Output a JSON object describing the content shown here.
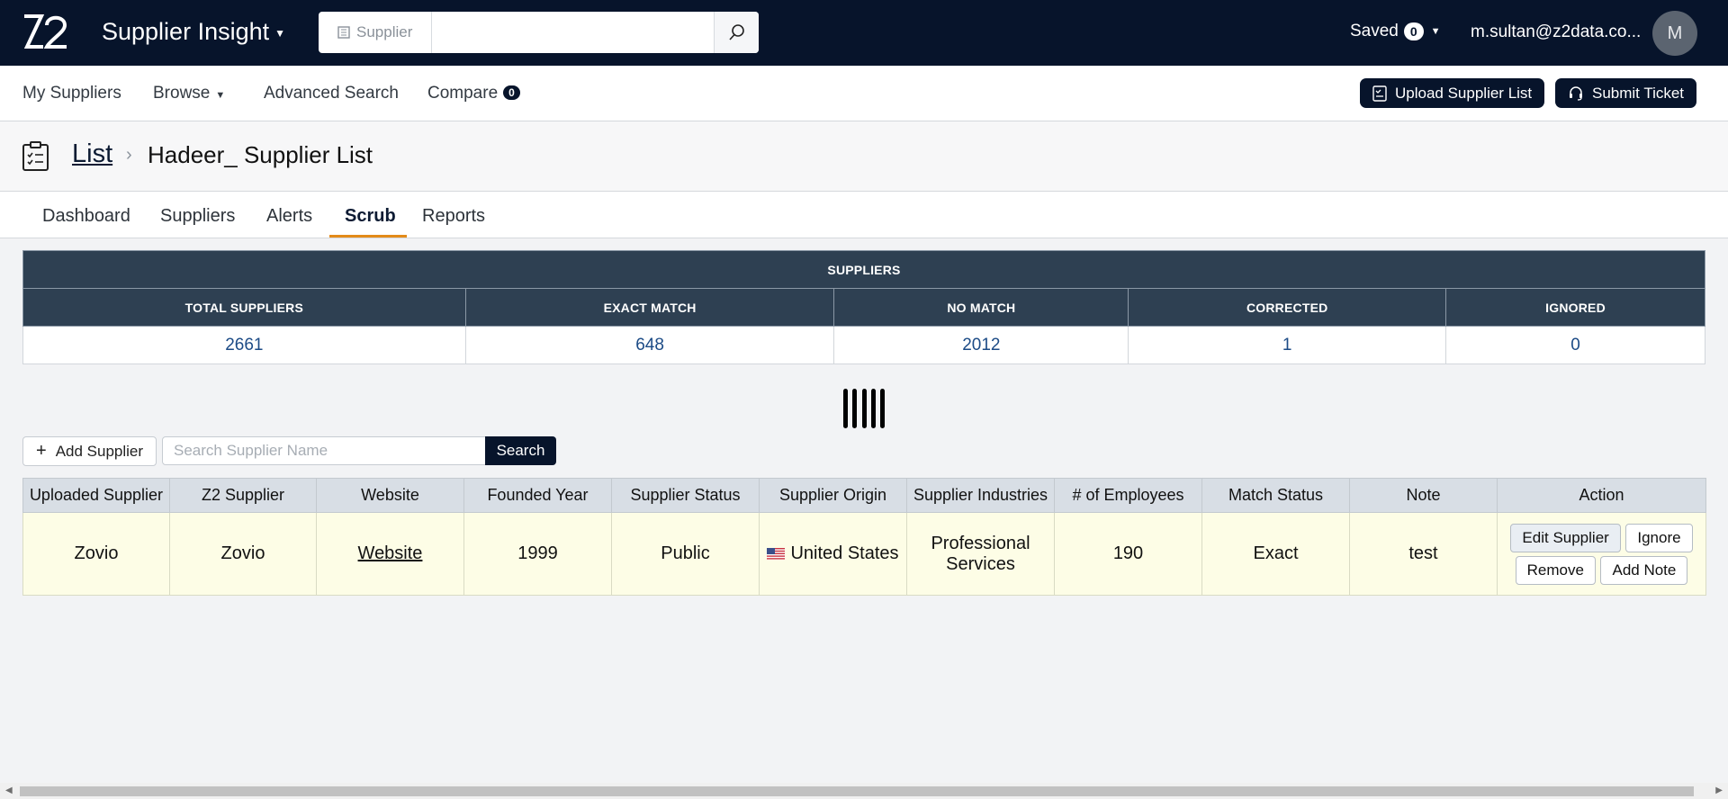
{
  "header": {
    "app_title": "Supplier Insight",
    "search_scope": "Supplier",
    "search_value": "",
    "saved_label": "Saved",
    "saved_count": "0",
    "user_email": "m.sultan@z2data.co...",
    "avatar_initial": "M"
  },
  "nav": {
    "my_suppliers": "My Suppliers",
    "browse": "Browse",
    "advanced_search": "Advanced Search",
    "compare": "Compare",
    "compare_count": "0",
    "upload_button": "Upload Supplier List",
    "submit_ticket": "Submit Ticket"
  },
  "breadcrumb": {
    "root": "List",
    "current": "Hadeer_ Supplier List"
  },
  "tabs": [
    "Dashboard",
    "Suppliers",
    "Alerts",
    "Scrub",
    "Reports"
  ],
  "active_tab": "Scrub",
  "summary": {
    "title": "SUPPLIERS",
    "columns": [
      "TOTAL SUPPLIERS",
      "EXACT MATCH",
      "NO MATCH",
      "CORRECTED",
      "IGNORED"
    ],
    "values": [
      "2661",
      "648",
      "2012",
      "1",
      "0"
    ]
  },
  "controls": {
    "add_supplier": "Add Supplier",
    "search_placeholder": "Search Supplier Name",
    "search_button": "Search"
  },
  "table": {
    "columns": [
      "Uploaded Supplier",
      "Z2 Supplier",
      "Website",
      "Founded Year",
      "Supplier Status",
      "Supplier Origin",
      "Supplier Industries",
      "# of Employees",
      "Match Status",
      "Note",
      "Action"
    ],
    "rows": [
      {
        "uploaded": "Zovio",
        "z2": "Zovio",
        "website": "Website",
        "founded": "1999",
        "status": "Public",
        "origin": "United States",
        "industries": "Professional Services",
        "employees": "190",
        "match": "Exact",
        "note": "test",
        "actions": {
          "edit": "Edit Supplier",
          "ignore": "Ignore",
          "remove": "Remove",
          "add_note": "Add Note"
        }
      }
    ]
  },
  "colors": {
    "navy": "#07142b",
    "table_header": "#2e4052",
    "accent_tab": "#e38b1a",
    "row_highlight": "#fdfde6"
  }
}
